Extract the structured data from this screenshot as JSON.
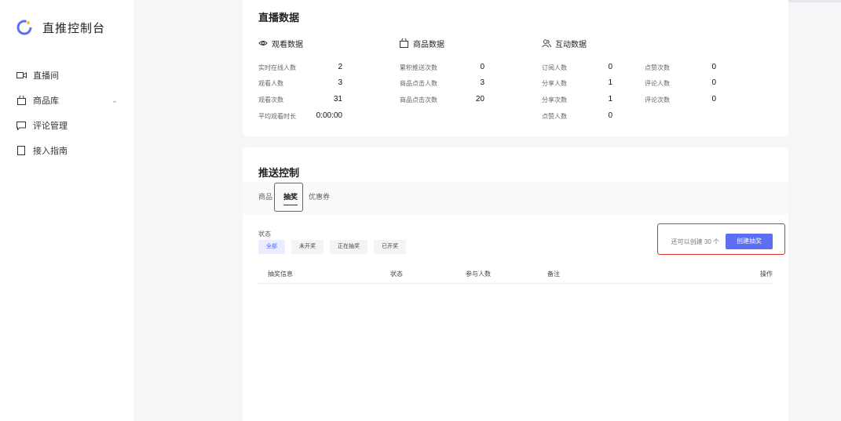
{
  "sidebar": {
    "title": "直推控制台",
    "items": [
      {
        "label": "直播间",
        "icon": "video-camera-icon"
      },
      {
        "label": "商品库",
        "icon": "shopping-bag-icon"
      },
      {
        "label": "评论管理",
        "icon": "comment-icon"
      },
      {
        "label": "接入指南",
        "icon": "document-icon"
      }
    ]
  },
  "stats": {
    "title": "直播数据",
    "groups": [
      {
        "heading": "观看数据",
        "icon": "eye-icon",
        "rows": [
          {
            "label": "实时在线人数",
            "value": "2"
          },
          {
            "label": "观看人数",
            "value": "3"
          },
          {
            "label": "观看次数",
            "value": "31"
          },
          {
            "label": "平均观看时长",
            "value": "0:00:00"
          }
        ]
      },
      {
        "heading": "商品数据",
        "icon": "shopping-bag-icon",
        "rows": [
          {
            "label": "累积推送次数",
            "value": "0"
          },
          {
            "label": "商品点击人数",
            "value": "3"
          },
          {
            "label": "商品点击次数",
            "value": "20"
          }
        ]
      },
      {
        "heading": "互动数据",
        "icon": "users-icon",
        "rows": [
          {
            "label": "订阅人数",
            "value": "0"
          },
          {
            "label": "分享人数",
            "value": "1"
          },
          {
            "label": "分享次数",
            "value": "1"
          },
          {
            "label": "点赞人数",
            "value": "0"
          }
        ],
        "rows2": [
          {
            "label": "点赞次数",
            "value": "0"
          },
          {
            "label": "评论人数",
            "value": "0"
          },
          {
            "label": "评论次数",
            "value": "0"
          }
        ]
      }
    ]
  },
  "push": {
    "title": "推送控制",
    "tabs": [
      "商品",
      "抽奖",
      "优惠券"
    ],
    "active_tab": "抽奖",
    "filter_label": "状态",
    "filters": [
      "全部",
      "未开奖",
      "正在抽奖",
      "已开奖"
    ],
    "create_hint": "还可以创建 30 个",
    "create_button": "创建抽奖",
    "columns": [
      "抽奖信息",
      "状态",
      "参与人数",
      "备注",
      "操作"
    ]
  },
  "colors": {
    "accent": "#5c6ef2",
    "highlight": "#e0312d"
  }
}
